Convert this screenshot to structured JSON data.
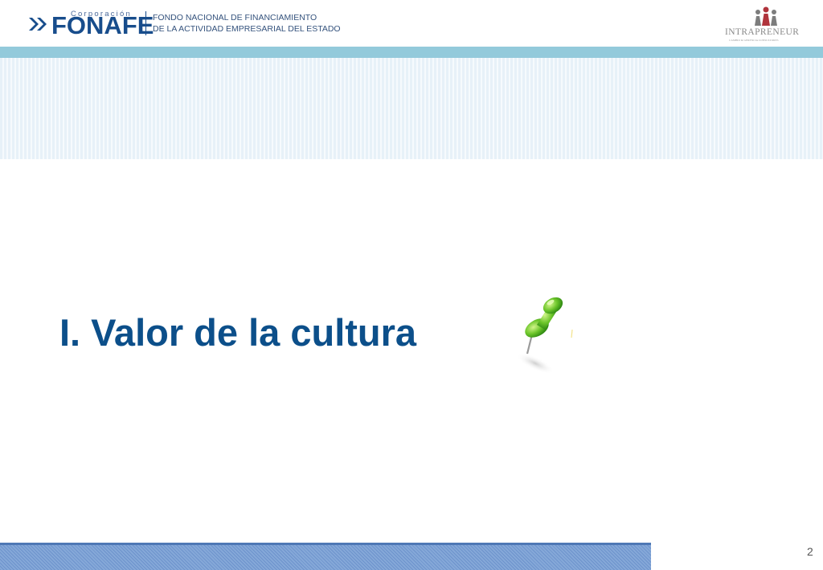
{
  "header": {
    "fonafe_logo": {
      "small_text": "Corporación",
      "wordmark": "FONAFE",
      "line1": "FONDO NACIONAL DE FINANCIAMIENTO",
      "line2": "DE LA ACTIVIDAD EMPRESARIAL DEL ESTADO",
      "brand_color": "#184d8c"
    },
    "intrapreneur_logo": {
      "name": "INTRAPRENEUR",
      "tagline": "CAMBIO & GERENCIA CONSULTORES",
      "accent_color": "#b0343c"
    }
  },
  "slide": {
    "title": "I. Valor de la cultura",
    "title_color": "#0c4f8a",
    "pin_icon": "green-pushpin-icon"
  },
  "footer": {
    "page_number": "2",
    "bar_color": "#7a9fd4"
  }
}
